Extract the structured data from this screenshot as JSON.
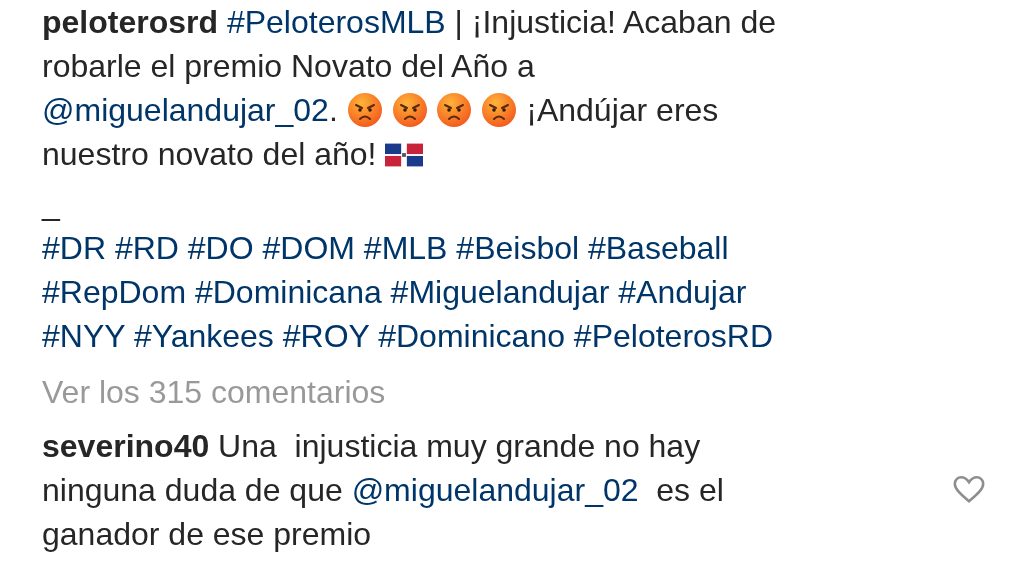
{
  "caption": {
    "lines": [
      [
        {
          "kind": "username",
          "text": "peloterosrd"
        },
        {
          "kind": "hashtag",
          "text": "#PeloterosMLB"
        },
        {
          "kind": "text",
          "text": "| ¡Injusticia! Acaban de"
        }
      ],
      [
        {
          "kind": "text",
          "text": "robarle el premio Novato del Año a"
        }
      ],
      [
        {
          "kind": "mention",
          "text": "@miguelandujar_02"
        },
        {
          "kind": "text",
          "text": "."
        },
        {
          "kind": "angry-emoji"
        },
        {
          "kind": "angry-emoji"
        },
        {
          "kind": "angry-emoji"
        },
        {
          "kind": "angry-emoji"
        },
        {
          "kind": "text",
          "text": "¡Andújar eres"
        }
      ],
      [
        {
          "kind": "text",
          "text": "nuestro novato del año!"
        },
        {
          "kind": "flag-emoji"
        }
      ]
    ],
    "separator": "_",
    "hashtag_lines": [
      [
        "#DR",
        "#RD",
        "#DO",
        "#DOM",
        "#MLB",
        "#Beisbol",
        "#Baseball"
      ],
      [
        "#RepDom",
        "#Dominicana",
        "#Miguelandujar",
        "#Andujar"
      ],
      [
        "#NYY",
        "#Yankees",
        "#ROY",
        "#Dominicano",
        "#PeloterosRD"
      ]
    ]
  },
  "view_comments": "Ver los 315 comentarios",
  "comment": {
    "liked": false,
    "lines": [
      [
        {
          "kind": "username",
          "text": "severino40"
        },
        {
          "kind": "text",
          "text": "Una  injusticia muy grande no hay"
        }
      ],
      [
        {
          "kind": "text",
          "text": "ninguna duda de que"
        },
        {
          "kind": "mention",
          "text": "@miguelandujar_02"
        },
        {
          "kind": "text",
          "text": " es el"
        }
      ],
      [
        {
          "kind": "text",
          "text": "ganador de ese premio"
        }
      ]
    ]
  }
}
